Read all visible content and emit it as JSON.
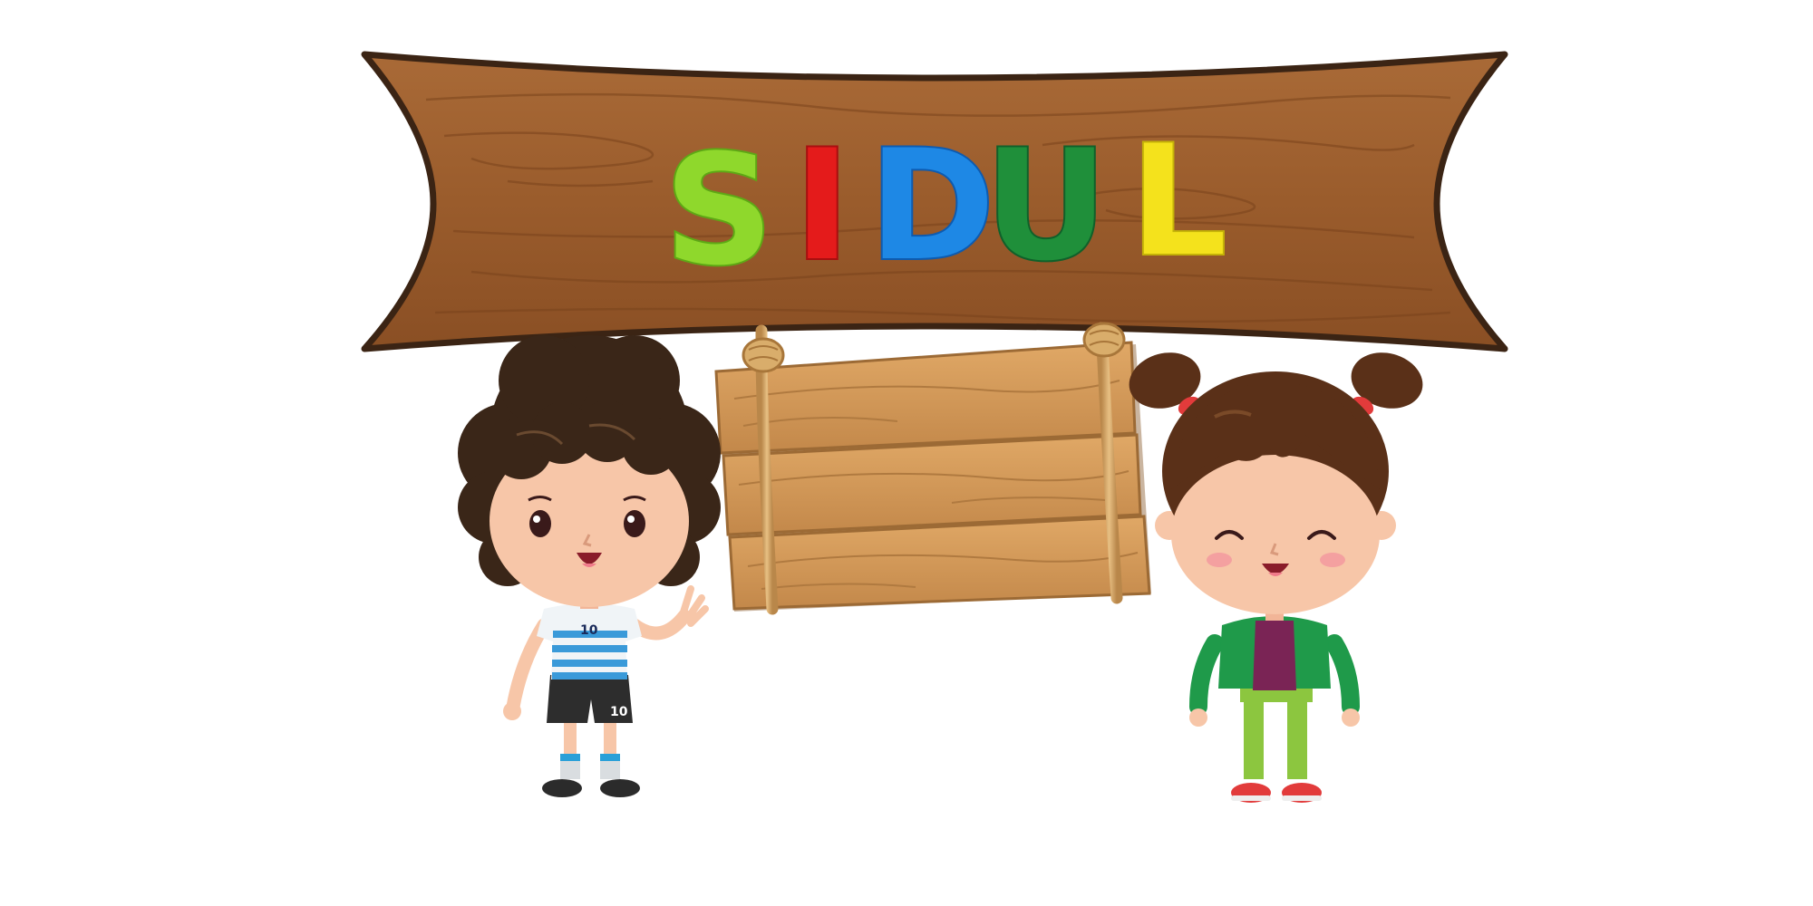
{
  "title": {
    "letters": [
      {
        "char": "S",
        "color": "#8fd82c",
        "shade": "#5ea815"
      },
      {
        "char": "I",
        "color": "#e41b1b",
        "shade": "#a80f0f"
      },
      {
        "char": "D",
        "color": "#1e88e5",
        "shade": "#0d5bb0"
      },
      {
        "char": "U",
        "color": "#1f8f3a",
        "shade": "#10602a"
      },
      {
        "char": "L",
        "color": "#f4e21c",
        "shade": "#c4b208"
      }
    ]
  },
  "board": {
    "wood": "#a0602f",
    "wood_dark": "#7e4520",
    "outline": "#3b2414"
  },
  "sign": {
    "text": ""
  },
  "characters": [
    {
      "name": "boy",
      "shirt_number": "10"
    },
    {
      "name": "girl"
    }
  ]
}
